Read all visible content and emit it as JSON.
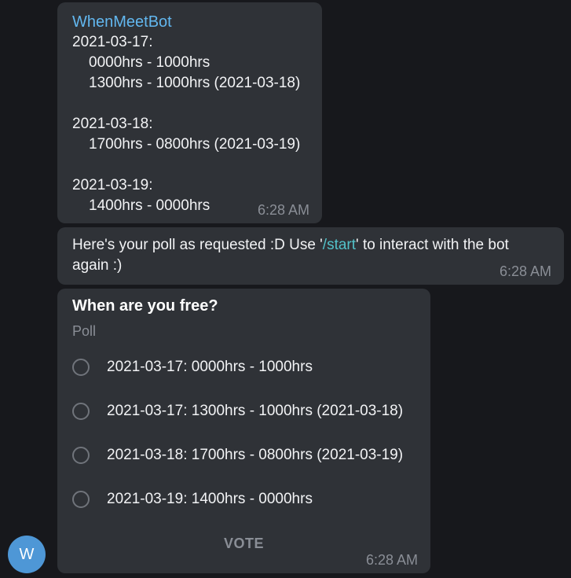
{
  "messages": {
    "schedule": {
      "sender": "WhenMeetBot",
      "lines": [
        "2021-03-17:",
        "0000hrs - 1000hrs",
        "1300hrs - 1000hrs (2021-03-18)",
        "",
        "2021-03-18:",
        "1700hrs - 0800hrs (2021-03-19)",
        "",
        "2021-03-19:",
        "1400hrs - 0000hrs"
      ],
      "time": "6:28 AM"
    },
    "notice": {
      "text_before": "Here's your poll as requested :D Use '",
      "command": "/start",
      "text_after": "' to interact with the bot again :)",
      "time": "6:28 AM"
    },
    "poll": {
      "question": "When are you free?",
      "type": "Poll",
      "options": [
        "2021-03-17: 0000hrs - 1000hrs",
        "2021-03-17: 1300hrs - 1000hrs (2021-03-18)",
        "2021-03-18: 1700hrs - 0800hrs (2021-03-19)",
        "2021-03-19: 1400hrs - 0000hrs"
      ],
      "vote_label": "VOTE",
      "time": "6:28 AM"
    }
  },
  "avatar": {
    "initial": "W",
    "color": "#4e97d6"
  },
  "colors": {
    "background": "#17181c",
    "bubble": "#2f3237",
    "sender": "#62b7ef",
    "command_link": "#52c2c9",
    "muted": "#8a8e96"
  }
}
